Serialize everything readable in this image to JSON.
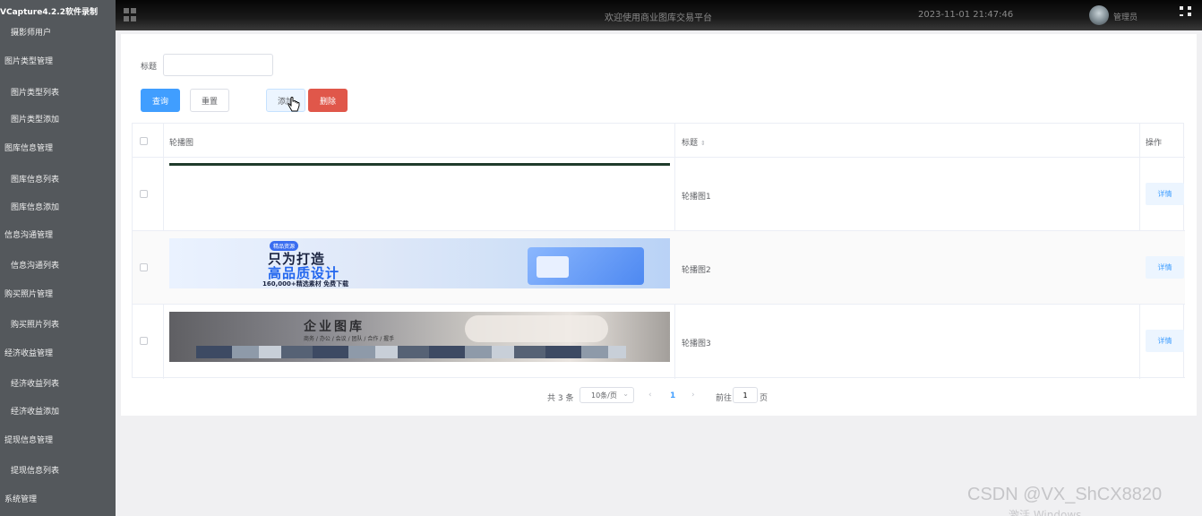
{
  "app": {
    "capture_label": "VCapture4.2.2软件录制"
  },
  "sidebar": {
    "items": [
      {
        "label": "摄影师用户",
        "type": "sub"
      },
      {
        "label": "图片类型管理",
        "type": "group"
      },
      {
        "label": "图片类型列表",
        "type": "sub"
      },
      {
        "label": "图片类型添加",
        "type": "sub"
      },
      {
        "label": "图库信息管理",
        "type": "group"
      },
      {
        "label": "图库信息列表",
        "type": "sub"
      },
      {
        "label": "图库信息添加",
        "type": "sub"
      },
      {
        "label": "信息沟通管理",
        "type": "group"
      },
      {
        "label": "信息沟通列表",
        "type": "sub"
      },
      {
        "label": "购买照片管理",
        "type": "group"
      },
      {
        "label": "购买照片列表",
        "type": "sub"
      },
      {
        "label": "经济收益管理",
        "type": "group"
      },
      {
        "label": "经济收益列表",
        "type": "sub"
      },
      {
        "label": "经济收益添加",
        "type": "sub"
      },
      {
        "label": "提现信息管理",
        "type": "group"
      },
      {
        "label": "提现信息列表",
        "type": "sub"
      },
      {
        "label": "系统管理",
        "type": "group"
      }
    ]
  },
  "header": {
    "title": "欢迎使用商业图库交易平台",
    "datetime": "2023-11-01 21:47:46",
    "user": "管理员"
  },
  "search": {
    "label": "标题",
    "value": "",
    "placeholder": ""
  },
  "toolbar": {
    "query_label": "查询",
    "reset_label": "重置",
    "add_label": "添加",
    "delete_label": "删除"
  },
  "table": {
    "columns": {
      "image": "轮播图",
      "title": "标题",
      "ops": "操作"
    },
    "rows": [
      {
        "title": "轮播图1",
        "detail_label": "详情"
      },
      {
        "title": "轮播图2",
        "detail_label": "详情"
      },
      {
        "title": "轮播图3",
        "detail_label": "详情"
      }
    ],
    "banner2": {
      "tag": "精品资源",
      "line1": "只为打造",
      "line2": "高品质设计",
      "line3": "160,000+精选素材 免费下载"
    },
    "banner3": {
      "title": "企业图库",
      "subtitle": "商务 / 办公 / 会议 / 团队 / 合作 / 握手"
    }
  },
  "pagination": {
    "total": "共 3 条",
    "page_size": "10条/页",
    "current_page": "1",
    "goto_label": "前往",
    "goto_value": "1",
    "page_suffix": "页"
  },
  "watermark": {
    "text": "CSDN @VX_ShCX8820",
    "os_text": "激活 Windows"
  },
  "colors": {
    "primary": "#409eff",
    "danger": "#e0574a",
    "sidebar_bg": "#54585c"
  }
}
